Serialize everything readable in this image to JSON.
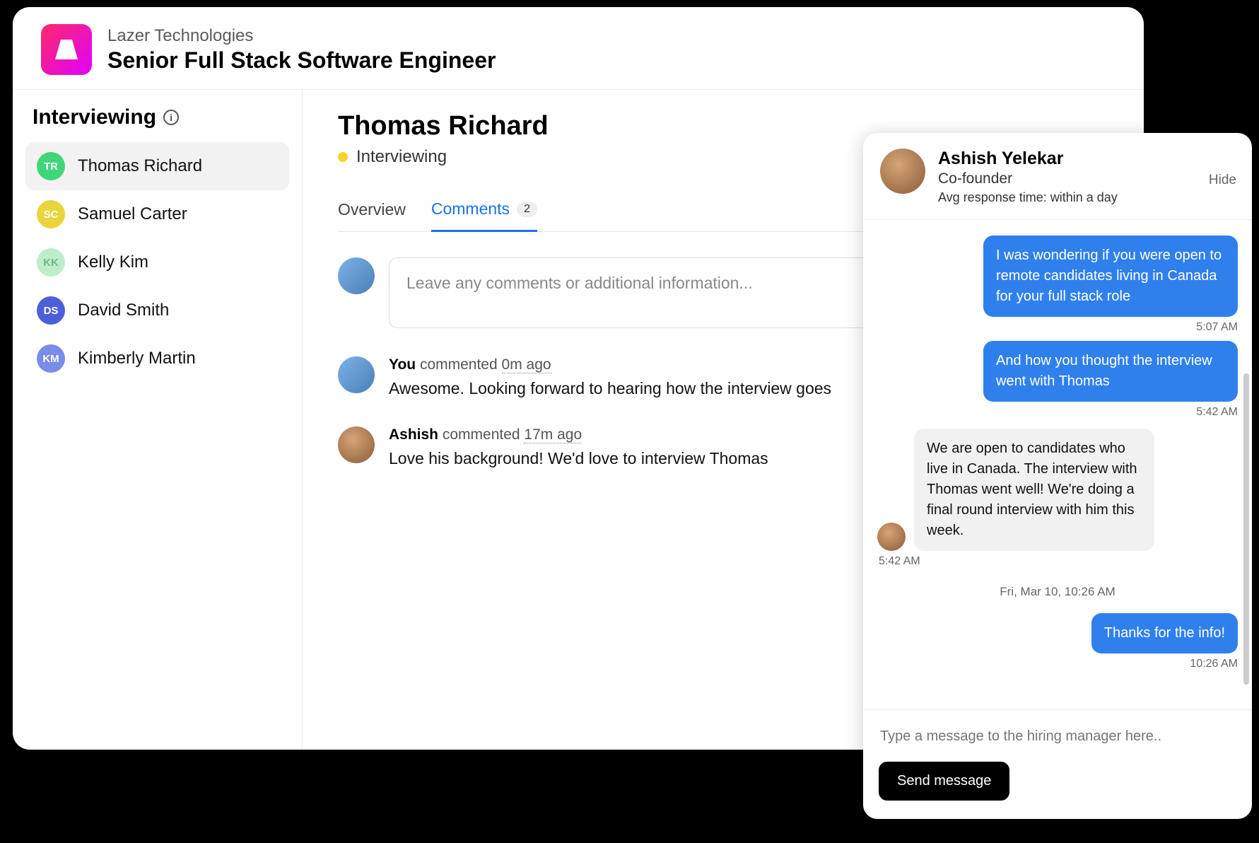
{
  "header": {
    "company": "Lazer Technologies",
    "job_title": "Senior Full Stack Software Engineer"
  },
  "sidebar": {
    "title": "Interviewing",
    "candidates": [
      {
        "initials": "TR",
        "name": "Thomas Richard",
        "color": "#3fd67a",
        "selected": true
      },
      {
        "initials": "SC",
        "name": "Samuel Carter",
        "color": "#e9d53b",
        "selected": false
      },
      {
        "initials": "KK",
        "name": "Kelly Kim",
        "color": "#bdeec9",
        "selected": false,
        "text_color": "#6fb983"
      },
      {
        "initials": "DS",
        "name": "David Smith",
        "color": "#4b5fd9",
        "selected": false
      },
      {
        "initials": "KM",
        "name": "Kimberly Martin",
        "color": "#7a8be8",
        "selected": false
      }
    ]
  },
  "content": {
    "candidate_name": "Thomas Richard",
    "status": "Interviewing",
    "tabs": {
      "overview": "Overview",
      "comments": "Comments",
      "comments_count": "2"
    },
    "compose_placeholder": "Leave any comments or additional information...",
    "comments": [
      {
        "author": "You",
        "action": "commented",
        "time": "0m ago",
        "body": "Awesome. Looking forward to hearing how the interview goes",
        "avatar": "you"
      },
      {
        "author": "Ashish",
        "action": "commented",
        "time": "17m ago",
        "body": "Love his background! We'd love to interview Thomas",
        "avatar": "ashish"
      }
    ]
  },
  "chat": {
    "name": "Ashish Yelekar",
    "role": "Co-founder",
    "response_meta": "Avg response time: within a day",
    "hide_label": "Hide",
    "messages": [
      {
        "side": "out",
        "text": "I was wondering if you were open to remote candidates living in Canada for your full stack role",
        "time": "5:07 AM"
      },
      {
        "side": "out",
        "text": "And how you thought the interview went with Thomas",
        "time": "5:42 AM"
      },
      {
        "side": "in",
        "text": "We are open to candidates who live in Canada. The interview with Thomas went well! We're doing a final round interview with him this week.",
        "time": "5:42 AM"
      },
      {
        "side": "sep",
        "text": "Fri, Mar 10, 10:26 AM"
      },
      {
        "side": "out",
        "text": "Thanks for the info!",
        "time": "10:26 AM"
      }
    ],
    "input_placeholder": "Type a message to the hiring manager here..",
    "send_label": "Send message"
  }
}
